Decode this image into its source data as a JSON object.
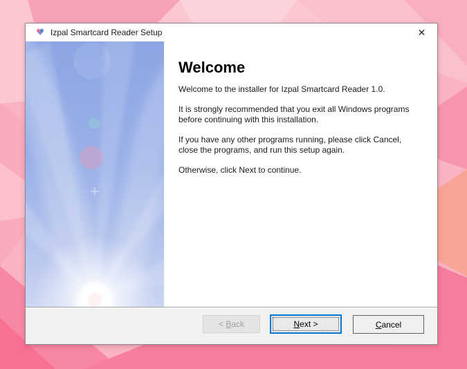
{
  "window": {
    "title": "Izpal Smartcard Reader Setup",
    "close_glyph": "✕"
  },
  "content": {
    "heading": "Welcome",
    "paragraphs": [
      "Welcome to the installer for Izpal Smartcard Reader 1.0.",
      "It is strongly recommended that you exit all Windows programs before continuing with this installation.",
      "If you have any other programs running, please click Cancel, close the programs, and run this setup again.",
      "Otherwise, click Next to continue."
    ]
  },
  "buttons": {
    "back": {
      "pre": "< ",
      "accel": "B",
      "post": "ack",
      "state": "disabled"
    },
    "next": {
      "pre": "",
      "accel": "N",
      "post": "ext >",
      "state": "default-focused"
    },
    "cancel": {
      "pre": "",
      "accel": "C",
      "post": "ancel",
      "state": "enabled"
    }
  },
  "colors": {
    "accent_focus": "#0078d7",
    "banner_top": "#8ca5e4",
    "banner_bottom": "#cbd6f3",
    "background_pink_light": "#fbd0d9",
    "background_pink_deep": "#f77e9d",
    "footer_gray": "#f1f1f1"
  }
}
